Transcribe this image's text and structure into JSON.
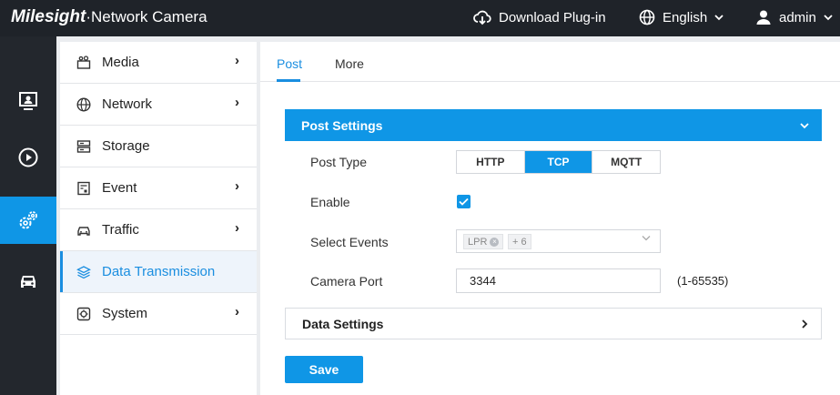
{
  "header": {
    "brand": "Milesight",
    "product": "·Network Camera",
    "download_label": "Download Plug-in",
    "language_label": "English",
    "user_label": "admin"
  },
  "rail": {
    "items": [
      {
        "icon": "live-view-icon"
      },
      {
        "icon": "playback-icon"
      },
      {
        "icon": "settings-gears-icon",
        "active": true
      },
      {
        "icon": "vehicle-icon"
      }
    ]
  },
  "menu": {
    "items": [
      {
        "label": "Media",
        "icon": "media-icon",
        "has_children": true
      },
      {
        "label": "Network",
        "icon": "globe-icon",
        "has_children": true
      },
      {
        "label": "Storage",
        "icon": "storage-icon",
        "has_children": false
      },
      {
        "label": "Event",
        "icon": "event-icon",
        "has_children": true
      },
      {
        "label": "Traffic",
        "icon": "car-icon",
        "has_children": true
      },
      {
        "label": "Data Transmission",
        "icon": "layers-icon",
        "has_children": false,
        "active": true
      },
      {
        "label": "System",
        "icon": "system-icon",
        "has_children": true
      }
    ],
    "chevron": "›"
  },
  "tabs": [
    {
      "label": "Post",
      "active": true
    },
    {
      "label": "More",
      "active": false
    }
  ],
  "post_settings": {
    "title": "Post Settings",
    "post_type": {
      "label": "Post Type",
      "options": [
        "HTTP",
        "TCP",
        "MQTT"
      ],
      "selected": "TCP"
    },
    "enable": {
      "label": "Enable",
      "checked": true
    },
    "select_events": {
      "label": "Select Events",
      "tags": [
        "LPR"
      ],
      "more": "+ 6"
    },
    "camera_port": {
      "label": "Camera Port",
      "value": "3344",
      "hint": "(1-65535)"
    }
  },
  "data_settings": {
    "title": "Data Settings"
  },
  "save_label": "Save",
  "colors": {
    "accent": "#0f96e6",
    "topbar": "#1f2329",
    "rail": "#23272d"
  }
}
